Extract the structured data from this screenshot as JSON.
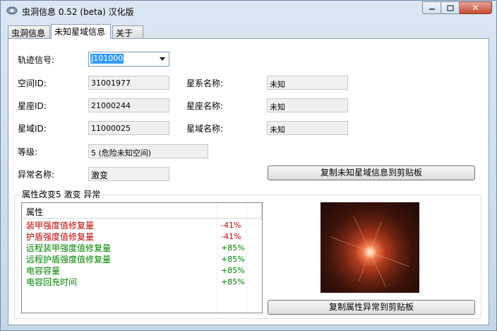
{
  "window": {
    "title": "虫洞信息 0.52 (beta) 汉化版",
    "close_glyph": "✕"
  },
  "tabs": [
    {
      "label": "虫洞信息"
    },
    {
      "label": "未知星域信息"
    },
    {
      "label": "关于"
    }
  ],
  "form": {
    "signal_label": "轨迹信号:",
    "signal_value": "J101000",
    "space_id_label": "空间ID:",
    "space_id_value": "31001977",
    "constellation_id_label": "星座ID:",
    "constellation_id_value": "21000244",
    "region_id_label": "星域ID:",
    "region_id_value": "11000025",
    "level_label": "等级:",
    "level_value": "5 (危险未知空间)",
    "anomaly_label": "异常名称:",
    "anomaly_value": "激变",
    "system_name_label": "星系名称:",
    "system_name_value": "未知",
    "constellation_name_label": "星座名称:",
    "constellation_name_value": "未知",
    "region_name_label": "星域名称:",
    "region_name_value": "未知",
    "copy_region_button": "复制未知星域信息到剪贴板"
  },
  "effects": {
    "group_title": "属性改变5 激变 异常",
    "column_header": "属性",
    "rows": [
      {
        "name": "装甲强度值修复量",
        "value": "-41%"
      },
      {
        "name": "护盾强度值修复量",
        "value": "-41%"
      },
      {
        "name": "远程装甲强度值修复量",
        "value": "+85%"
      },
      {
        "name": "远程护盾强度值修复量",
        "value": "+85%"
      },
      {
        "name": "电容容量",
        "value": "+85%"
      },
      {
        "name": "电容回充时间",
        "value": "+85%"
      }
    ],
    "copy_effects_button": "复制属性异常到剪贴板"
  },
  "colors": {
    "negative": "#c00000",
    "positive": "#008000",
    "selection": "#3399ff"
  }
}
